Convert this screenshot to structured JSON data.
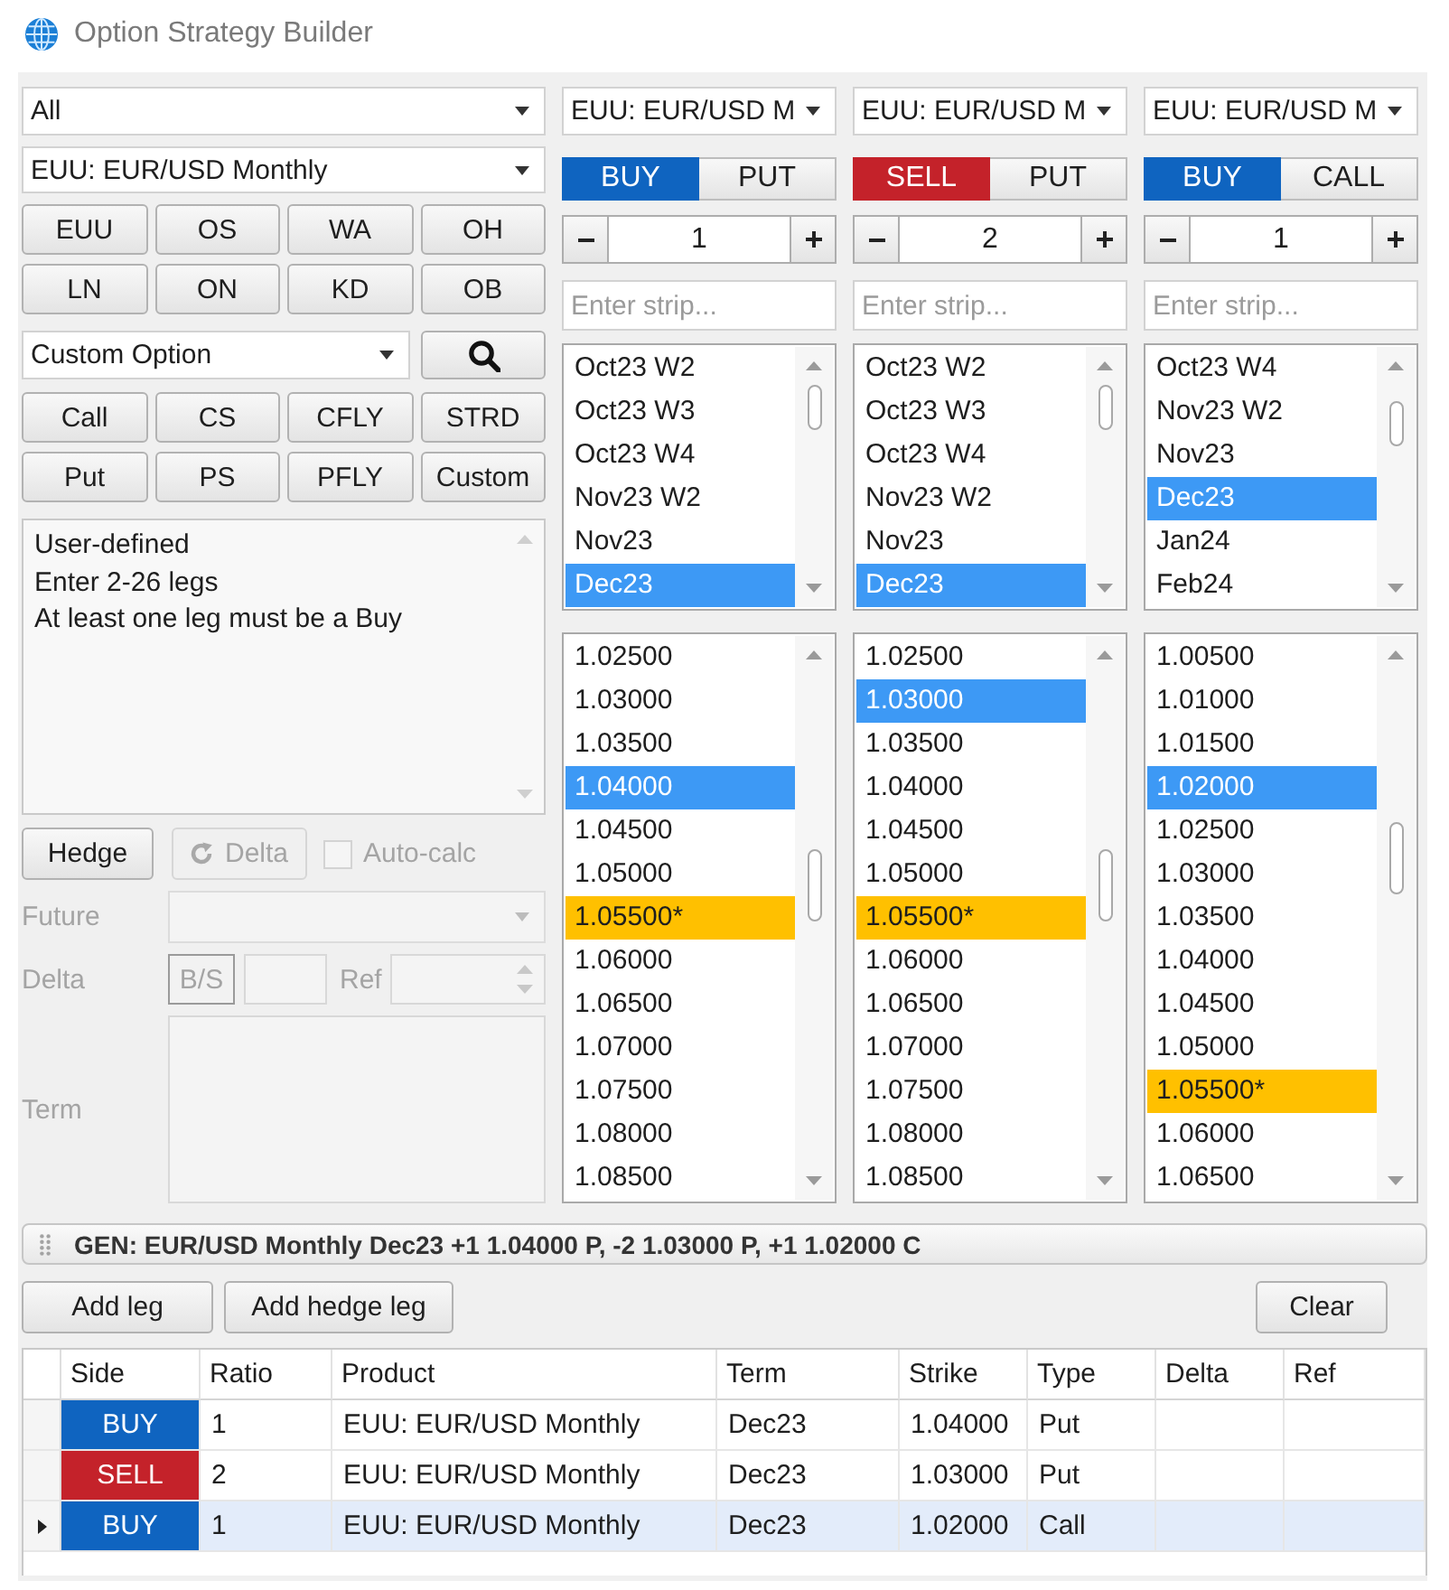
{
  "window": {
    "title": "Option Strategy Builder"
  },
  "filters": {
    "category": "All",
    "product": "EUU: EUR/USD Monthly"
  },
  "product_buttons": [
    "EUU",
    "OS",
    "WA",
    "OH",
    "LN",
    "ON",
    "KD",
    "OB"
  ],
  "strategy": {
    "value": "Custom Option"
  },
  "strategy_buttons": [
    "Call",
    "CS",
    "CFLY",
    "STRD",
    "Put",
    "PS",
    "PFLY",
    "Custom"
  ],
  "description": [
    "User-defined",
    "Enter 2-26 legs",
    "At least one leg must be a Buy"
  ],
  "hedge": {
    "button": {
      "label": "Hedge",
      "disabled": false
    },
    "delta_button": {
      "label": "Delta",
      "disabled": true
    },
    "auto_calc": {
      "label": "Auto-calc",
      "checked": false,
      "disabled": true
    },
    "fields": {
      "disabled": true,
      "future_label": "Future",
      "delta_label": "Delta",
      "side_button": "B/S",
      "ref_label": "Ref",
      "term_label": "Term"
    }
  },
  "legs": [
    {
      "product": "EUU: EUR/USD M",
      "side": {
        "label": "BUY",
        "kind": "buy"
      },
      "option_type": "PUT",
      "ratio": "1",
      "strip_placeholder": "Enter strip...",
      "terms": [
        {
          "label": "Oct23 W2",
          "selected": false
        },
        {
          "label": "Oct23 W3",
          "selected": false
        },
        {
          "label": "Oct23 W4",
          "selected": false
        },
        {
          "label": "Nov23 W2",
          "selected": false
        },
        {
          "label": "Nov23",
          "selected": false
        },
        {
          "label": "Dec23",
          "selected": true
        }
      ],
      "strikes": [
        {
          "label": "1.02500",
          "selected": false,
          "atm": false
        },
        {
          "label": "1.03000",
          "selected": false,
          "atm": false
        },
        {
          "label": "1.03500",
          "selected": false,
          "atm": false
        },
        {
          "label": "1.04000",
          "selected": true,
          "atm": false
        },
        {
          "label": "1.04500",
          "selected": false,
          "atm": false
        },
        {
          "label": "1.05000",
          "selected": false,
          "atm": false
        },
        {
          "label": "1.05500*",
          "selected": false,
          "atm": true
        },
        {
          "label": "1.06000",
          "selected": false,
          "atm": false
        },
        {
          "label": "1.06500",
          "selected": false,
          "atm": false
        },
        {
          "label": "1.07000",
          "selected": false,
          "atm": false
        },
        {
          "label": "1.07500",
          "selected": false,
          "atm": false
        },
        {
          "label": "1.08000",
          "selected": false,
          "atm": false
        },
        {
          "label": "1.08500",
          "selected": false,
          "atm": false
        }
      ]
    },
    {
      "product": "EUU: EUR/USD M",
      "side": {
        "label": "SELL",
        "kind": "sell"
      },
      "option_type": "PUT",
      "ratio": "2",
      "strip_placeholder": "Enter strip...",
      "terms": [
        {
          "label": "Oct23 W2",
          "selected": false
        },
        {
          "label": "Oct23 W3",
          "selected": false
        },
        {
          "label": "Oct23 W4",
          "selected": false
        },
        {
          "label": "Nov23 W2",
          "selected": false
        },
        {
          "label": "Nov23",
          "selected": false
        },
        {
          "label": "Dec23",
          "selected": true
        }
      ],
      "strikes": [
        {
          "label": "1.02500",
          "selected": false,
          "atm": false
        },
        {
          "label": "1.03000",
          "selected": true,
          "atm": false
        },
        {
          "label": "1.03500",
          "selected": false,
          "atm": false
        },
        {
          "label": "1.04000",
          "selected": false,
          "atm": false
        },
        {
          "label": "1.04500",
          "selected": false,
          "atm": false
        },
        {
          "label": "1.05000",
          "selected": false,
          "atm": false
        },
        {
          "label": "1.05500*",
          "selected": false,
          "atm": true
        },
        {
          "label": "1.06000",
          "selected": false,
          "atm": false
        },
        {
          "label": "1.06500",
          "selected": false,
          "atm": false
        },
        {
          "label": "1.07000",
          "selected": false,
          "atm": false
        },
        {
          "label": "1.07500",
          "selected": false,
          "atm": false
        },
        {
          "label": "1.08000",
          "selected": false,
          "atm": false
        },
        {
          "label": "1.08500",
          "selected": false,
          "atm": false
        }
      ]
    },
    {
      "product": "EUU: EUR/USD M",
      "side": {
        "label": "BUY",
        "kind": "buy"
      },
      "option_type": "CALL",
      "ratio": "1",
      "strip_placeholder": "Enter strip...",
      "terms": [
        {
          "label": "Oct23 W4",
          "selected": false
        },
        {
          "label": "Nov23 W2",
          "selected": false
        },
        {
          "label": "Nov23",
          "selected": false
        },
        {
          "label": "Dec23",
          "selected": true
        },
        {
          "label": "Jan24",
          "selected": false
        },
        {
          "label": "Feb24",
          "selected": false
        }
      ],
      "strikes": [
        {
          "label": "1.00500",
          "selected": false,
          "atm": false
        },
        {
          "label": "1.01000",
          "selected": false,
          "atm": false
        },
        {
          "label": "1.01500",
          "selected": false,
          "atm": false
        },
        {
          "label": "1.02000",
          "selected": true,
          "atm": false
        },
        {
          "label": "1.02500",
          "selected": false,
          "atm": false
        },
        {
          "label": "1.03000",
          "selected": false,
          "atm": false
        },
        {
          "label": "1.03500",
          "selected": false,
          "atm": false
        },
        {
          "label": "1.04000",
          "selected": false,
          "atm": false
        },
        {
          "label": "1.04500",
          "selected": false,
          "atm": false
        },
        {
          "label": "1.05000",
          "selected": false,
          "atm": false
        },
        {
          "label": "1.05500*",
          "selected": false,
          "atm": true
        },
        {
          "label": "1.06000",
          "selected": false,
          "atm": false
        },
        {
          "label": "1.06500",
          "selected": false,
          "atm": false
        }
      ]
    }
  ],
  "summary": {
    "text": "GEN: EUR/USD Monthly Dec23 +1 1.04000 P, -2 1.03000 P, +1 1.02000 C"
  },
  "actions": {
    "add_leg": "Add leg",
    "add_hedge_leg": "Add hedge leg",
    "clear": "Clear"
  },
  "table": {
    "columns": [
      "Side",
      "Ratio",
      "Product",
      "Term",
      "Strike",
      "Type",
      "Delta",
      "Ref"
    ],
    "rows": [
      {
        "side": {
          "label": "BUY",
          "kind": "buy"
        },
        "ratio": "1",
        "product": "EUU: EUR/USD Monthly",
        "term": "Dec23",
        "strike": "1.04000",
        "type": "Put",
        "selected": false
      },
      {
        "side": {
          "label": "SELL",
          "kind": "sell"
        },
        "ratio": "2",
        "product": "EUU: EUR/USD Monthly",
        "term": "Dec23",
        "strike": "1.03000",
        "type": "Put",
        "selected": false
      },
      {
        "side": {
          "label": "BUY",
          "kind": "buy"
        },
        "ratio": "1",
        "product": "EUU: EUR/USD Monthly",
        "term": "Dec23",
        "strike": "1.02000",
        "type": "Call",
        "selected": true
      }
    ]
  }
}
